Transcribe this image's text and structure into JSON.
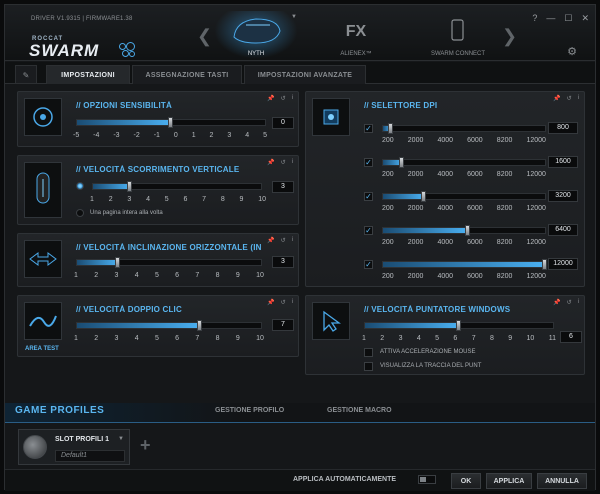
{
  "titlebar": {
    "driver": "DRIVER V1.9315 | FIRMWARE1.38",
    "logo_top": "ROCCAT",
    "logo": "SWARM"
  },
  "devices": [
    {
      "label": "NYTH",
      "active": true
    },
    {
      "label": "ALIENEX™",
      "name_mark": "FX",
      "active": false
    },
    {
      "label": "SWARM CONNECT",
      "active": false
    }
  ],
  "tabs": [
    {
      "label": "IMPOSTAZIONI",
      "active": true
    },
    {
      "label": "ASSEGNAZIONE TASTI",
      "active": false
    },
    {
      "label": "IMPOSTAZIONI AVANZATE",
      "active": false
    }
  ],
  "sensitivity": {
    "title": "// OPZIONI SENSIBILITÀ",
    "ticks": [
      "-5",
      "-4",
      "-3",
      "-2",
      "-1",
      "0",
      "1",
      "2",
      "3",
      "4",
      "5"
    ],
    "value": "0",
    "level": 0
  },
  "vscroll": {
    "title": "// VELOCITÀ SCORRIMENTO VERTICALE",
    "ticks": [
      "1",
      "2",
      "3",
      "4",
      "5",
      "6",
      "7",
      "8",
      "9",
      "10"
    ],
    "value": "3",
    "level": 3,
    "option": "Una pagina intera alla volta"
  },
  "hscroll": {
    "title": "// VELOCITÀ INCLINAZIONE ORIZZONTALE (IN",
    "ticks": [
      "1",
      "2",
      "3",
      "4",
      "5",
      "6",
      "7",
      "8",
      "9",
      "10"
    ],
    "value": "3",
    "level": 3
  },
  "dblclick": {
    "title": "// VELOCITÀ DOPPIO CLIC",
    "ticks": [
      "1",
      "2",
      "3",
      "4",
      "5",
      "6",
      "7",
      "8",
      "9",
      "10"
    ],
    "value": "7",
    "level": 7,
    "area_test": "AREA TEST"
  },
  "dpi": {
    "title": "// SELETTORE DPI",
    "ticks": [
      "200",
      "2000",
      "4000",
      "6000",
      "8200",
      "12000"
    ],
    "rows": [
      {
        "value": "800",
        "dpi": 800
      },
      {
        "value": "1600",
        "dpi": 1600
      },
      {
        "value": "3200",
        "dpi": 3200
      },
      {
        "value": "6400",
        "dpi": 6400
      },
      {
        "value": "12000",
        "dpi": 12000
      }
    ]
  },
  "pointer": {
    "title": "// VELOCITÀ PUNTATORE WINDOWS",
    "ticks": [
      "1",
      "2",
      "3",
      "4",
      "5",
      "6",
      "7",
      "8",
      "9",
      "10",
      "11"
    ],
    "value": "6",
    "level": 6,
    "options": [
      "ATTIVA ACCELERAZIONE MOUSE",
      "VISUALIZZA LA TRACCIA DEL PUNT"
    ]
  },
  "profiles": {
    "title": "GAME PROFILES",
    "tabs": [
      "GESTIONE PROFILO",
      "GESTIONE MACRO"
    ],
    "slot_name": "SLOT PROFILI 1",
    "slot_default": "Default1"
  },
  "footer": {
    "auto_apply": "APPLICA AUTOMATICAMENTE",
    "ok": "OK",
    "apply": "APPLICA",
    "cancel": "ANNULLA"
  },
  "colors": {
    "accent": "#5ab6f0",
    "bg": "#151719"
  }
}
